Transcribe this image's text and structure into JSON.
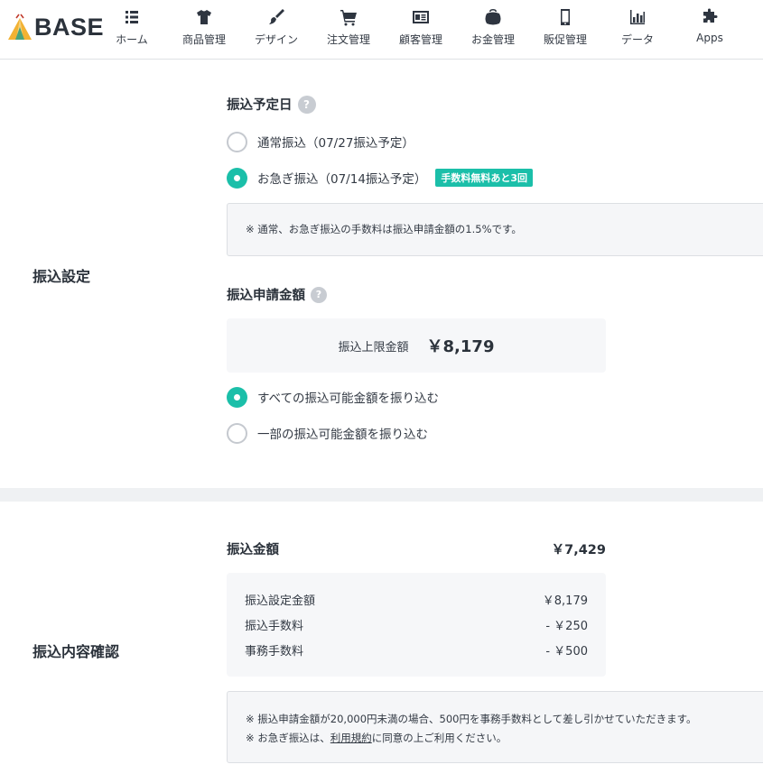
{
  "header": {
    "logo_text": "BASE",
    "nav": [
      {
        "label": "ホーム",
        "icon": "list-icon"
      },
      {
        "label": "商品管理",
        "icon": "shirt-icon"
      },
      {
        "label": "デザイン",
        "icon": "brush-icon"
      },
      {
        "label": "注文管理",
        "icon": "cart-icon"
      },
      {
        "label": "顧客管理",
        "icon": "id-card-icon"
      },
      {
        "label": "お金管理",
        "icon": "wallet-icon"
      },
      {
        "label": "販促管理",
        "icon": "smartphone-icon"
      },
      {
        "label": "データ",
        "icon": "bar-chart-icon"
      },
      {
        "label": "Apps",
        "icon": "puzzle-icon"
      }
    ]
  },
  "transfer_settings": {
    "section_title": "振込設定",
    "schedule": {
      "title": "振込予定日",
      "help": "?",
      "options": [
        {
          "label": "通常振込（07/27振込予定）",
          "selected": false
        },
        {
          "label": "お急ぎ振込（07/14振込予定）",
          "selected": true,
          "badge": "手数料無料あと3回"
        }
      ],
      "note": "※ 通常、お急ぎ振込の手数料は振込申請金額の1.5%です。"
    },
    "request_amount": {
      "title": "振込申請金額",
      "help": "?",
      "limit_label": "振込上限金額",
      "limit_value": "￥8,179",
      "options": [
        {
          "label": "すべての振込可能金額を振り込む",
          "selected": true
        },
        {
          "label": "一部の振込可能金額を振り込む",
          "selected": false
        }
      ]
    }
  },
  "confirmation": {
    "section_title": "振込内容確認",
    "amount_label": "振込金額",
    "amount_value": "￥7,429",
    "breakdown": [
      {
        "label": "振込設定金額",
        "value": "￥8,179"
      },
      {
        "label": "振込手数料",
        "value": "- ￥250"
      },
      {
        "label": "事務手数料",
        "value": "- ￥500"
      }
    ],
    "notes": {
      "line1": "※ 振込申請金額が20,000円未満の場合、500円を事務手数料として差し引かせていただきます。",
      "line2_prefix": "※ お急ぎ振込は、",
      "line2_link": "利用規約",
      "line2_suffix": "に同意の上ご利用ください。"
    }
  },
  "colors": {
    "accent": "#1bbfa9",
    "text": "#333a44",
    "panel": "#f6f7f9",
    "band": "#eff1f3"
  }
}
